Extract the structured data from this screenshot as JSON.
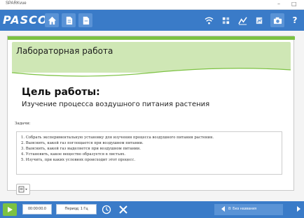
{
  "window": {
    "title": "SPARKvue",
    "controls": [
      "–",
      "□"
    ]
  },
  "toolbar": {
    "logo": "PASCO",
    "left_icons": [
      "home-icon",
      "page-icon",
      "page-add-icon"
    ],
    "right_icons": [
      "wifi-icon",
      "sensor-grid-icon",
      "analysis-icon",
      "chart-icon",
      "camera-icon",
      "help-icon"
    ],
    "help_label": "?"
  },
  "lab": {
    "header": "Лабораторная работа",
    "goal_title": "Цель работы:",
    "goal_text": "Изучение процесса воздушного питания растения",
    "tasks_label": "Задачи:",
    "tasks": [
      "1. Собрать экспериментальную установку для изучения процесса воздушного питания растения.",
      "2. Выяснить, какой газ поглощается при воздушном питании.",
      "3. Выяснить, какой газ выделяется при воздушном питании.",
      "4. Установить, какое вещество образуется в листьях.",
      "5. Изучить, при каких условиях происходит этот процесс."
    ]
  },
  "bottombar": {
    "time": "00:00:00.0",
    "period": "Период: 1 Гц",
    "page_label": "8: Без названия"
  },
  "colors": {
    "accent": "#3a7bc8",
    "green": "#7cc242",
    "header_band": "#cfe7b5"
  }
}
